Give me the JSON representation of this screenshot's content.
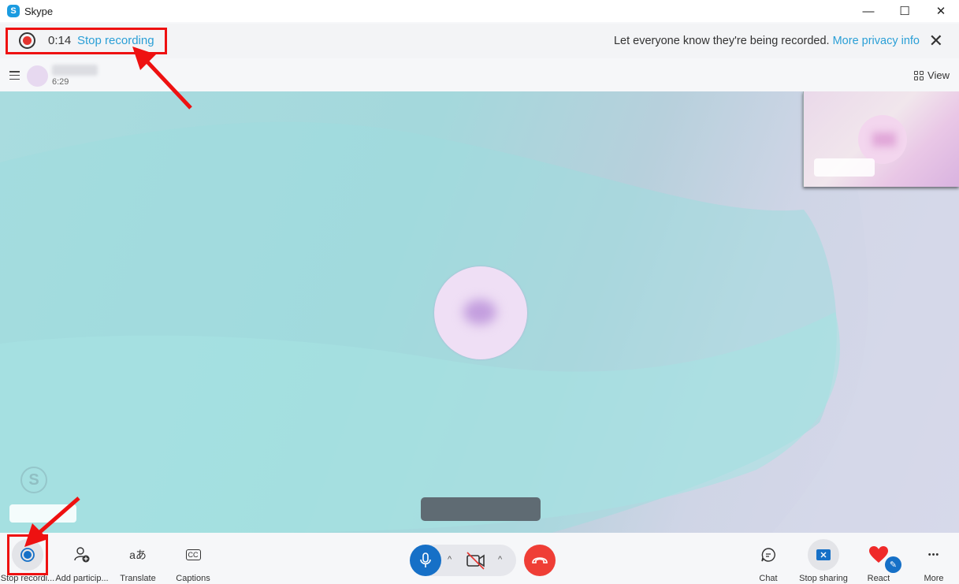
{
  "window": {
    "title": "Skype",
    "logo_glyph": "S",
    "minimize_glyph": "—",
    "maximize_glyph": "☐",
    "close_glyph": "✕"
  },
  "recording_bar": {
    "elapsed": "0:14",
    "stop_label": "Stop recording",
    "notice": "Let everyone know they're being recorded.",
    "privacy_link": "More privacy info",
    "close_glyph": "✕"
  },
  "call_header": {
    "call_duration": "6:29",
    "view_label": "View"
  },
  "stage": {
    "watermark_glyph": "S"
  },
  "toolbar": {
    "left": [
      {
        "id": "stop-recording",
        "label": "Stop recordi..."
      },
      {
        "id": "add-participants",
        "label": "Add particip..."
      },
      {
        "id": "translate",
        "label": "Translate",
        "glyph": "aあ"
      },
      {
        "id": "captions",
        "label": "Captions",
        "glyph": "CC"
      }
    ],
    "center": {
      "chevron_glyph": "^"
    },
    "right": [
      {
        "id": "chat",
        "label": "Chat"
      },
      {
        "id": "stop-sharing",
        "label": "Stop sharing"
      },
      {
        "id": "react",
        "label": "React"
      },
      {
        "id": "more",
        "label": "More",
        "glyph": "•••"
      }
    ]
  },
  "colors": {
    "accent": "#2a9fd6",
    "record_red": "#e3342f",
    "mic_blue": "#1670c7",
    "end_call_red": "#ef3e36",
    "annotation_red": "#ee1111"
  }
}
